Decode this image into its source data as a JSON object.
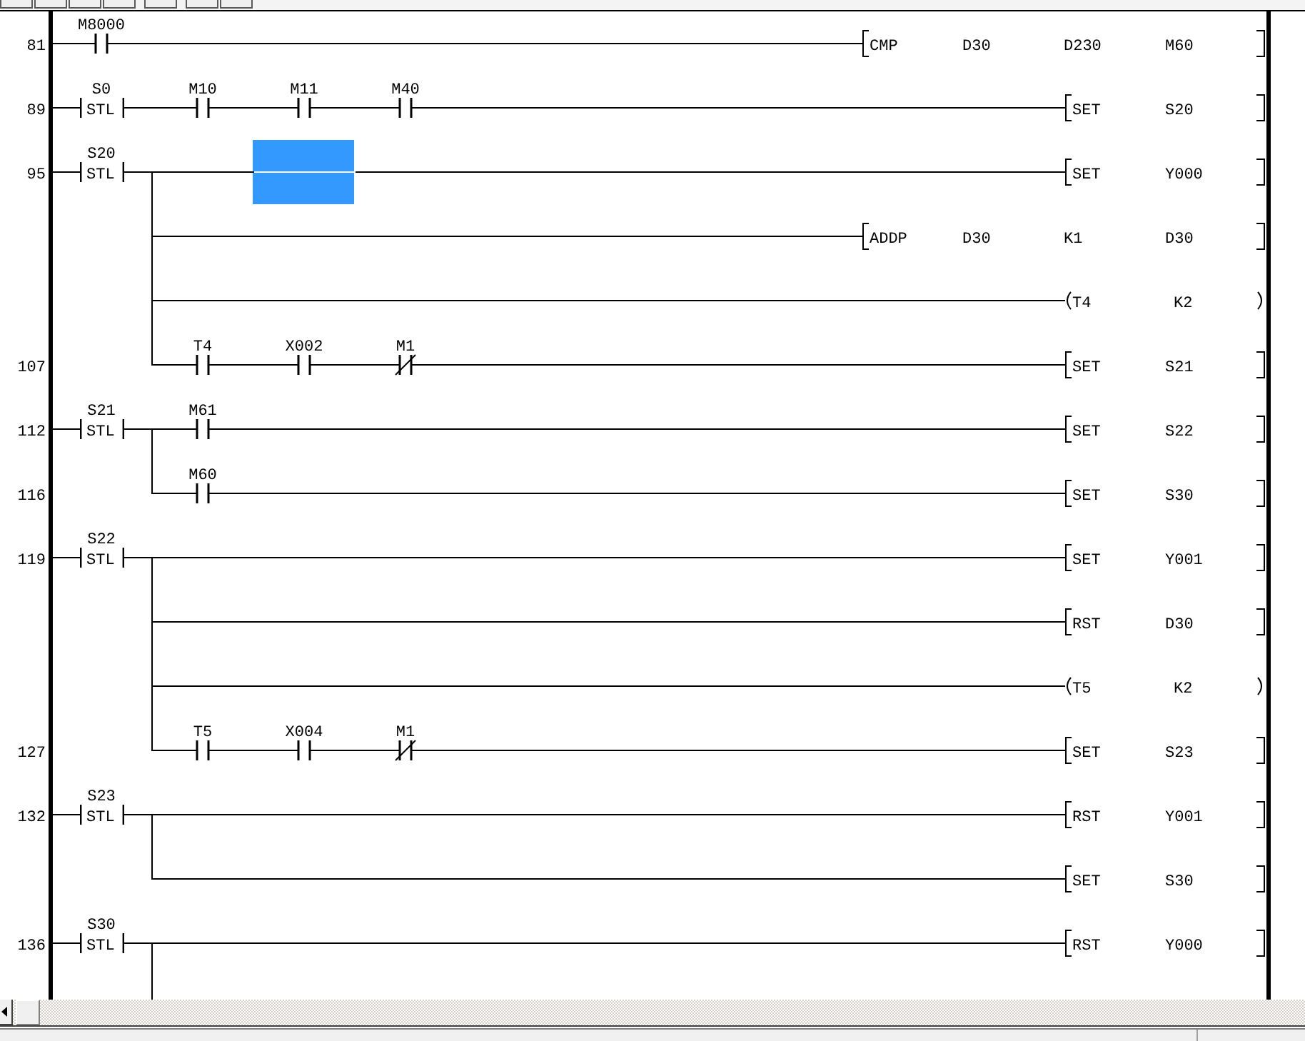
{
  "ladder": {
    "rungs": [
      {
        "lines": [
          {
            "step": "81",
            "cells": [
              {
                "kind": "contact_no",
                "device": "M8000",
                "selected": false
              }
            ],
            "output": {
              "kind": "bracket",
              "parts": [
                "CMP",
                "D30",
                "D230",
                "M60"
              ]
            }
          }
        ]
      },
      {
        "stl": {
          "device": "S0",
          "text": "STL"
        },
        "lines": [
          {
            "step": "89",
            "cells": [
              {
                "kind": "contact_no",
                "device": "M10",
                "selected": false
              },
              {
                "kind": "contact_no",
                "device": "M11",
                "selected": false
              },
              {
                "kind": "contact_no",
                "device": "M40",
                "selected": false
              }
            ],
            "output": {
              "kind": "bracket",
              "parts": [
                "SET",
                "S20"
              ]
            }
          }
        ]
      },
      {
        "stl": {
          "device": "S20",
          "text": "STL"
        },
        "lines": [
          {
            "step": "95",
            "cells": [
              {
                "kind": "wire",
                "selected": false
              },
              {
                "kind": "wire",
                "selected": true
              }
            ],
            "output": {
              "kind": "bracket",
              "parts": [
                "SET",
                "Y000"
              ]
            }
          },
          {
            "output": {
              "kind": "bracket",
              "parts": [
                "ADDP",
                "D30",
                "K1",
                "D30"
              ]
            }
          },
          {
            "output": {
              "kind": "coil",
              "parts": [
                "T4",
                "K2"
              ]
            }
          },
          {
            "step": "107",
            "cells": [
              {
                "kind": "contact_no",
                "device": "T4",
                "selected": false
              },
              {
                "kind": "contact_no",
                "device": "X002",
                "selected": false
              },
              {
                "kind": "contact_nc",
                "device": "M1",
                "selected": false
              }
            ],
            "output": {
              "kind": "bracket",
              "parts": [
                "SET",
                "S21"
              ]
            }
          }
        ]
      },
      {
        "stl": {
          "device": "S21",
          "text": "STL"
        },
        "lines": [
          {
            "step": "112",
            "cells": [
              {
                "kind": "contact_no",
                "device": "M61",
                "selected": false
              }
            ],
            "output": {
              "kind": "bracket",
              "parts": [
                "SET",
                "S22"
              ]
            }
          },
          {
            "step": "116",
            "cells": [
              {
                "kind": "contact_no",
                "device": "M60",
                "selected": false
              }
            ],
            "output": {
              "kind": "bracket",
              "parts": [
                "SET",
                "S30"
              ]
            }
          }
        ]
      },
      {
        "stl": {
          "device": "S22",
          "text": "STL"
        },
        "lines": [
          {
            "step": "119",
            "output": {
              "kind": "bracket",
              "parts": [
                "SET",
                "Y001"
              ]
            }
          },
          {
            "output": {
              "kind": "bracket",
              "parts": [
                "RST",
                "D30"
              ]
            }
          },
          {
            "output": {
              "kind": "coil",
              "parts": [
                "T5",
                "K2"
              ]
            }
          },
          {
            "step": "127",
            "cells": [
              {
                "kind": "contact_no",
                "device": "T5",
                "selected": false
              },
              {
                "kind": "contact_no",
                "device": "X004",
                "selected": false
              },
              {
                "kind": "contact_nc",
                "device": "M1",
                "selected": false
              }
            ],
            "output": {
              "kind": "bracket",
              "parts": [
                "SET",
                "S23"
              ]
            }
          }
        ]
      },
      {
        "stl": {
          "device": "S23",
          "text": "STL"
        },
        "lines": [
          {
            "step": "132",
            "output": {
              "kind": "bracket",
              "parts": [
                "RST",
                "Y001"
              ]
            }
          },
          {
            "output": {
              "kind": "bracket",
              "parts": [
                "SET",
                "S30"
              ]
            }
          }
        ]
      },
      {
        "stl": {
          "device": "S30",
          "text": "STL"
        },
        "continues_below": true,
        "lines": [
          {
            "step": "136",
            "output": {
              "kind": "bracket",
              "parts": [
                "RST",
                "Y000"
              ]
            }
          }
        ]
      }
    ]
  }
}
